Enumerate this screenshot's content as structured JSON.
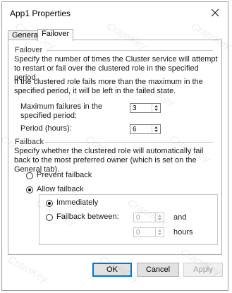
{
  "window": {
    "title": "App1 Properties",
    "close_icon": "close-icon"
  },
  "tabs": [
    {
      "label": "General",
      "selected": false
    },
    {
      "label": "Failover",
      "selected": true
    }
  ],
  "failover": {
    "group_label": "Failover",
    "description": "Specify the number of times the Cluster service will attempt to restart or fail over the clustered role in the specified period.",
    "note": "If the clustered role fails more than the maximum in the specified period, it will be left in the failed state.",
    "max_failures_label": "Maximum failures in the specified period:",
    "max_failures_value": "3",
    "period_label": "Period (hours):",
    "period_value": "6"
  },
  "failback": {
    "group_label": "Failback",
    "description": "Specify whether the clustered role will automatically fail back to the most preferred owner (which is set on the General tab).",
    "prevent_label": "Prevent failback",
    "prevent_selected": false,
    "allow_label": "Allow failback",
    "allow_selected": true,
    "immediately_label": "Immediately",
    "immediately_selected": true,
    "between_label": "Failback between:",
    "between_selected": false,
    "between_from": "0",
    "between_to": "0",
    "and_label": "and",
    "hours_label": "hours"
  },
  "buttons": {
    "ok": "OK",
    "cancel": "Cancel",
    "apply": "Apply"
  },
  "watermark": {
    "text": "CramKey"
  }
}
